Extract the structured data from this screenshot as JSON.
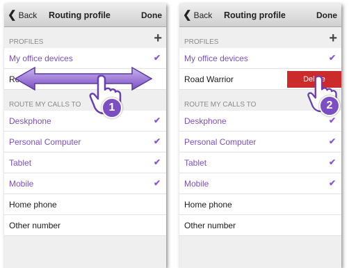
{
  "screens": [
    {
      "nav": {
        "back": "Back",
        "title": "Routing profile",
        "done": "Done"
      },
      "profiles_header": "PROFILES",
      "profiles": [
        "My office devices",
        "Road Warrior"
      ],
      "route_header": "ROUTE MY CALLS TO",
      "devices": [
        "Deskphone",
        "Personal Computer",
        "Tablet",
        "Mobile",
        "Home phone",
        "Other number"
      ],
      "step": "1"
    },
    {
      "nav": {
        "back": "Back",
        "title": "Routing profile",
        "done": "Done"
      },
      "profiles_header": "PROFILES",
      "profiles": [
        "My office devices",
        "Road Warrior"
      ],
      "delete_label": "Delete",
      "route_header": "ROUTE MY CALLS TO",
      "devices": [
        "Deskphone",
        "Personal Computer",
        "Tablet",
        "Mobile",
        "Home phone",
        "Other number"
      ],
      "step": "2"
    }
  ],
  "colors": {
    "selected_text": "#7b4fc2",
    "check": "#8a55d8",
    "delete": "#cc2b2b",
    "badge": "#7b4fc2"
  },
  "icons": {
    "back": "chevron-left-icon",
    "add": "plus-icon",
    "check": "checkmark-icon",
    "swipe": "double-arrow-icon",
    "hand": "pointing-hand-icon"
  }
}
